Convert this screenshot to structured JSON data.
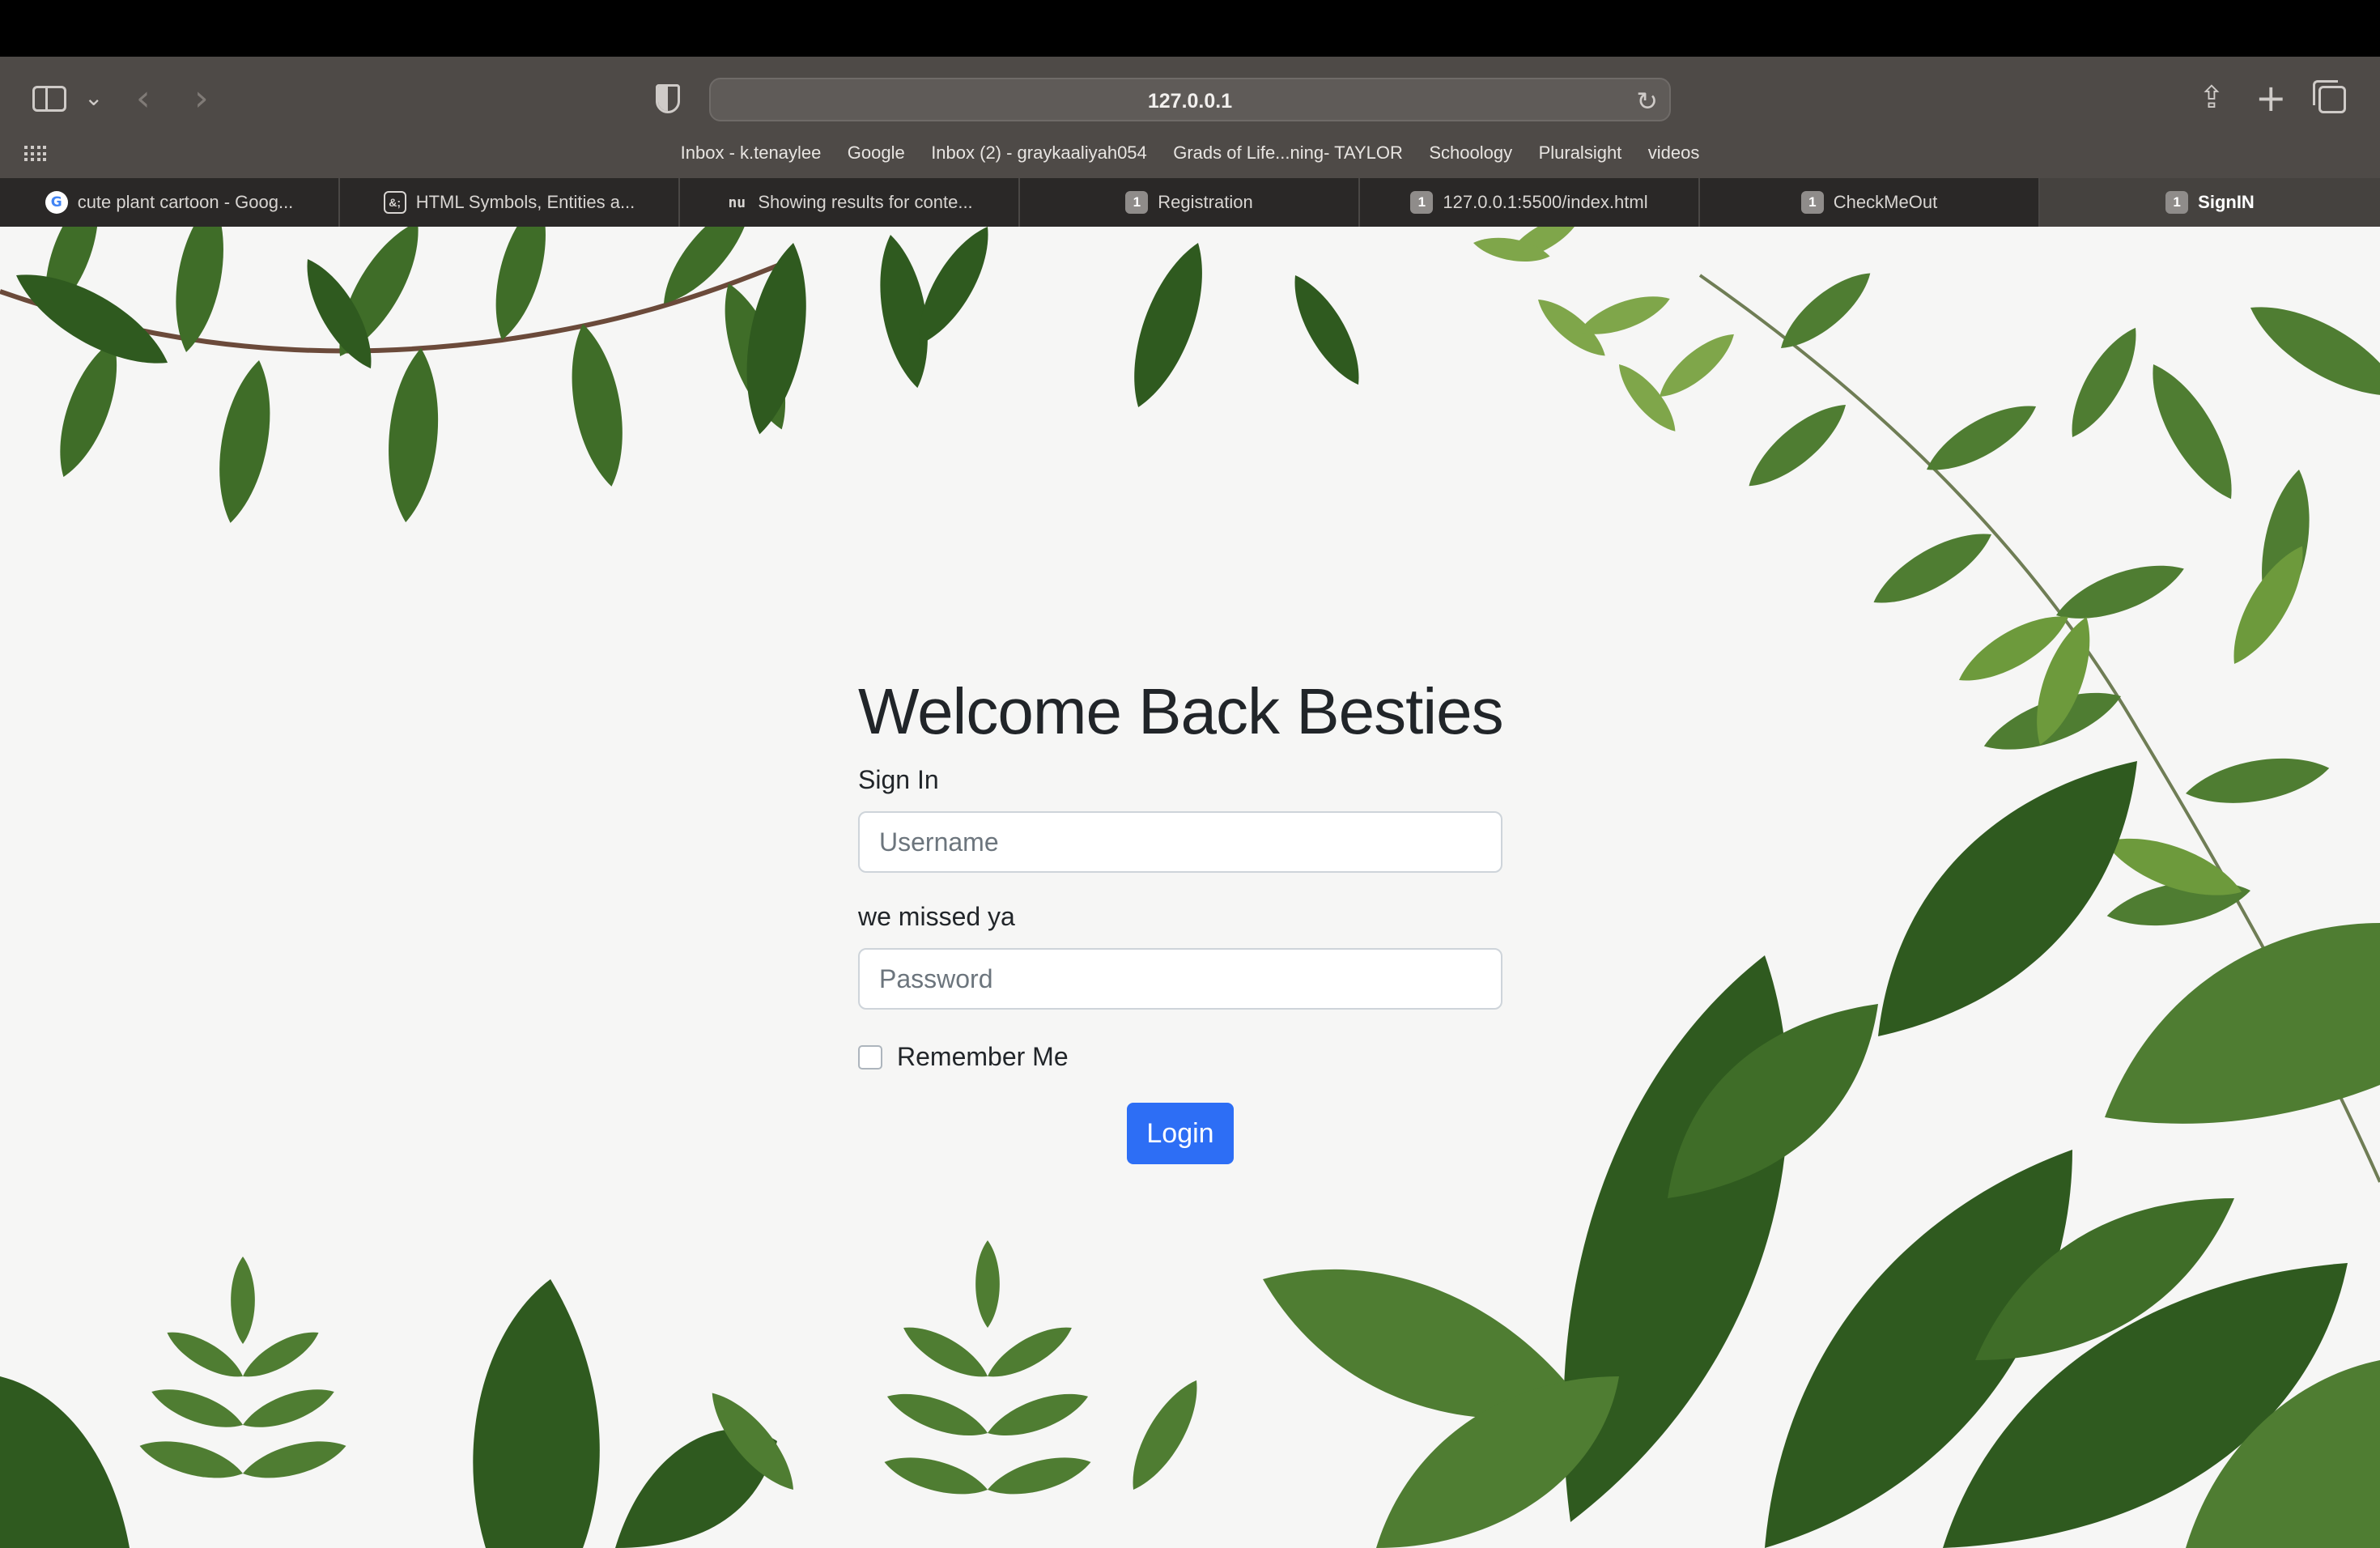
{
  "browser": {
    "url": "127.0.0.1",
    "favorites": [
      "Inbox - k.tenaylee",
      "Google",
      "Inbox (2) - graykaaliyah054",
      "Grads of Life...ning- TAYLOR",
      "Schoology",
      "Pluralsight",
      "videos"
    ],
    "tabs": [
      {
        "label": "cute plant cartoon - Goog...",
        "favicon": "G"
      },
      {
        "label": "HTML Symbols, Entities a...",
        "favicon": "&;"
      },
      {
        "label": "Showing results for conte...",
        "favicon": "nu"
      },
      {
        "label": "Registration",
        "favicon": "1"
      },
      {
        "label": "127.0.0.1:5500/index.html",
        "favicon": "1"
      },
      {
        "label": "CheckMeOut",
        "favicon": "1"
      },
      {
        "label": "SignIN",
        "favicon": "1"
      }
    ],
    "icons": {
      "sidebar": "sidebar-icon",
      "back": "chevron-left-icon",
      "forward": "chevron-right-icon",
      "privacy": "shield-icon",
      "reload": "reload-icon",
      "share": "share-icon",
      "new_tab": "plus-icon",
      "tab_overview": "tabs-icon",
      "favorites_grid": "grid-icon"
    }
  },
  "page": {
    "title": "Welcome Back Besties",
    "sign_in_label": "Sign In",
    "username_placeholder": "Username",
    "password_label": "we missed ya",
    "password_placeholder": "Password",
    "remember_label": "Remember Me",
    "login_label": "Login"
  },
  "colors": {
    "primary_button": "#2d6ef5",
    "leaf_dark": "#2f5a1f",
    "leaf_mid": "#4f7d32",
    "leaf_light": "#7fa64a"
  }
}
